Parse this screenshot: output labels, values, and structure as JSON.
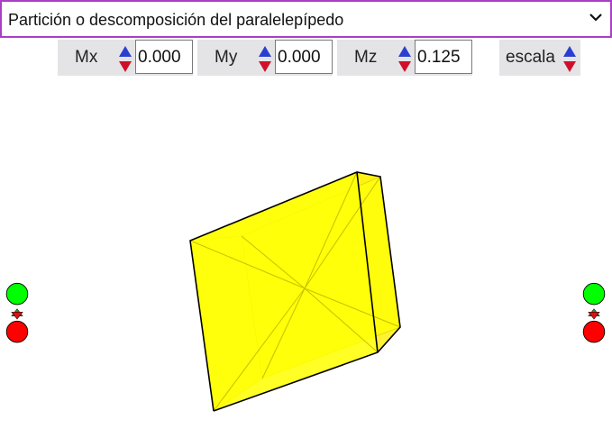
{
  "selector": {
    "selected": "Partición o descomposición del paralelepípedo",
    "icon": "chevron-down-icon"
  },
  "controls": [
    {
      "label": "Mx",
      "value": "0.000"
    },
    {
      "label": "My",
      "value": "0.000"
    },
    {
      "label": "Mz",
      "value": "0.125"
    },
    {
      "label": "escala"
    }
  ],
  "colors": {
    "solid_fill": "#ffff00",
    "edge": "#000000",
    "increase": "#2a3fd0",
    "decrease": "#d0102a",
    "go_button": "#00ff00",
    "stop_button": "#ff0000",
    "border_accent": "#a93fc7"
  },
  "side_controls": {
    "left": {
      "top_icon": "green-circle-icon",
      "middle_icon": "updown-arrows-icon",
      "bottom_icon": "red-circle-icon"
    },
    "right": {
      "top_icon": "green-circle-icon",
      "middle_icon": "updown-arrows-icon",
      "bottom_icon": "red-circle-icon"
    }
  }
}
